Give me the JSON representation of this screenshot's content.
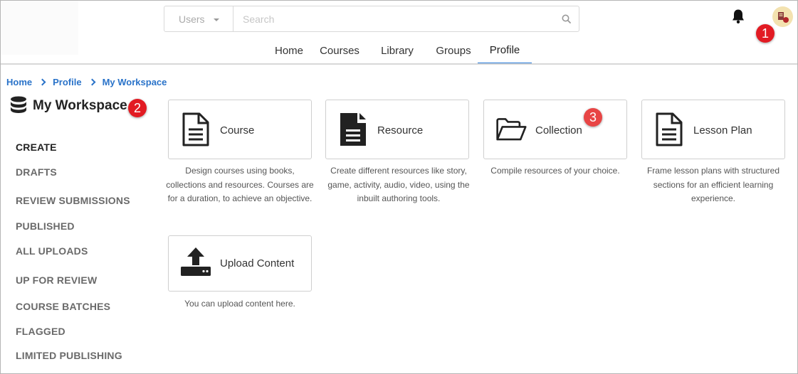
{
  "header": {
    "search": {
      "scope_label": "Users",
      "placeholder": "Search"
    },
    "nav": [
      {
        "label": "Home"
      },
      {
        "label": "Courses"
      },
      {
        "label": "Library"
      },
      {
        "label": "Groups"
      },
      {
        "label": "Profile",
        "active": true
      }
    ],
    "accent_color": "#2477d8"
  },
  "markers": [
    "1",
    "2",
    "3"
  ],
  "breadcrumb": [
    "Home",
    "Profile",
    "My Workspace"
  ],
  "workspace": {
    "title": "My Workspace"
  },
  "sidebar": {
    "items": [
      {
        "label": "CREATE",
        "active": true
      },
      {
        "label": "DRAFTS"
      },
      {
        "label": "REVIEW SUBMISSIONS"
      },
      {
        "label": "PUBLISHED"
      },
      {
        "label": "ALL UPLOADS"
      },
      {
        "label": "UP FOR REVIEW"
      },
      {
        "label": "COURSE BATCHES"
      },
      {
        "label": "FLAGGED"
      },
      {
        "label": "LIMITED PUBLISHING"
      }
    ]
  },
  "cards": [
    {
      "label": "Course",
      "icon": "document-outline-icon",
      "description": "Design courses using books, collections and resources. Courses are for a duration, to achieve an objective."
    },
    {
      "label": "Resource",
      "icon": "document-filled-icon",
      "description": "Create different resources like story, game, activity, audio, video, using the inbuilt authoring tools."
    },
    {
      "label": "Collection",
      "icon": "folder-open-icon",
      "description": "Compile resources of your choice."
    },
    {
      "label": "Lesson Plan",
      "icon": "document-outline-icon",
      "description": "Frame lesson plans with structured sections for an efficient learning experience."
    },
    {
      "label": "Upload Content",
      "icon": "upload-icon",
      "description": "You can upload content here."
    }
  ]
}
